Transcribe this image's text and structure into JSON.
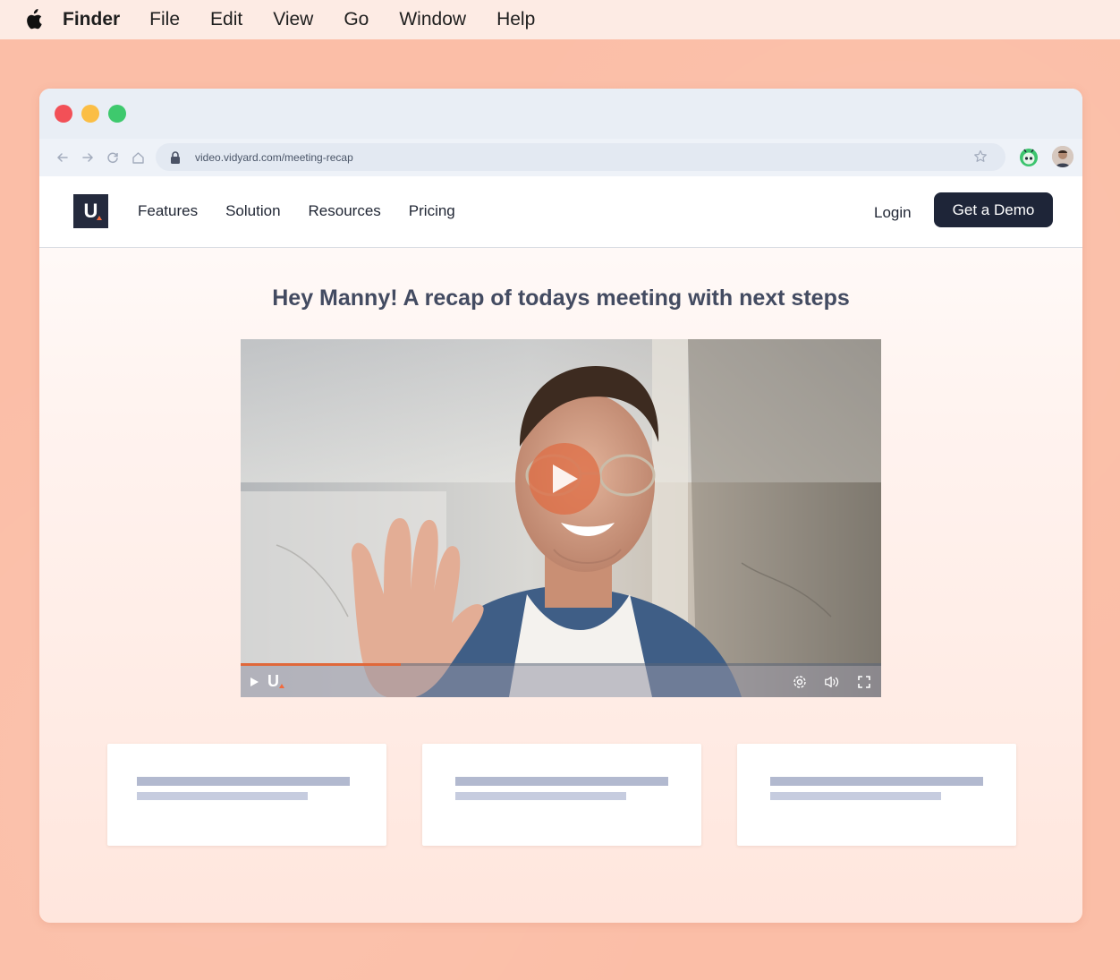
{
  "menubar": {
    "items": [
      "Finder",
      "File",
      "Edit",
      "View",
      "Go",
      "Window",
      "Help"
    ]
  },
  "browser": {
    "url": "video.vidyard.com/meeting-recap"
  },
  "site": {
    "logo_letter": "U",
    "nav": [
      "Features",
      "Solution",
      "Resources",
      "Pricing"
    ],
    "login_label": "Login",
    "demo_label": "Get a Demo"
  },
  "main": {
    "headline": "Hey Manny! A recap of todays meeting with next steps"
  },
  "video": {
    "player_logo": "U",
    "progress": 0.25
  },
  "colors": {
    "accent": "#e0683a",
    "brand_dark": "#1e2538",
    "desktop": "#fbbea7"
  }
}
